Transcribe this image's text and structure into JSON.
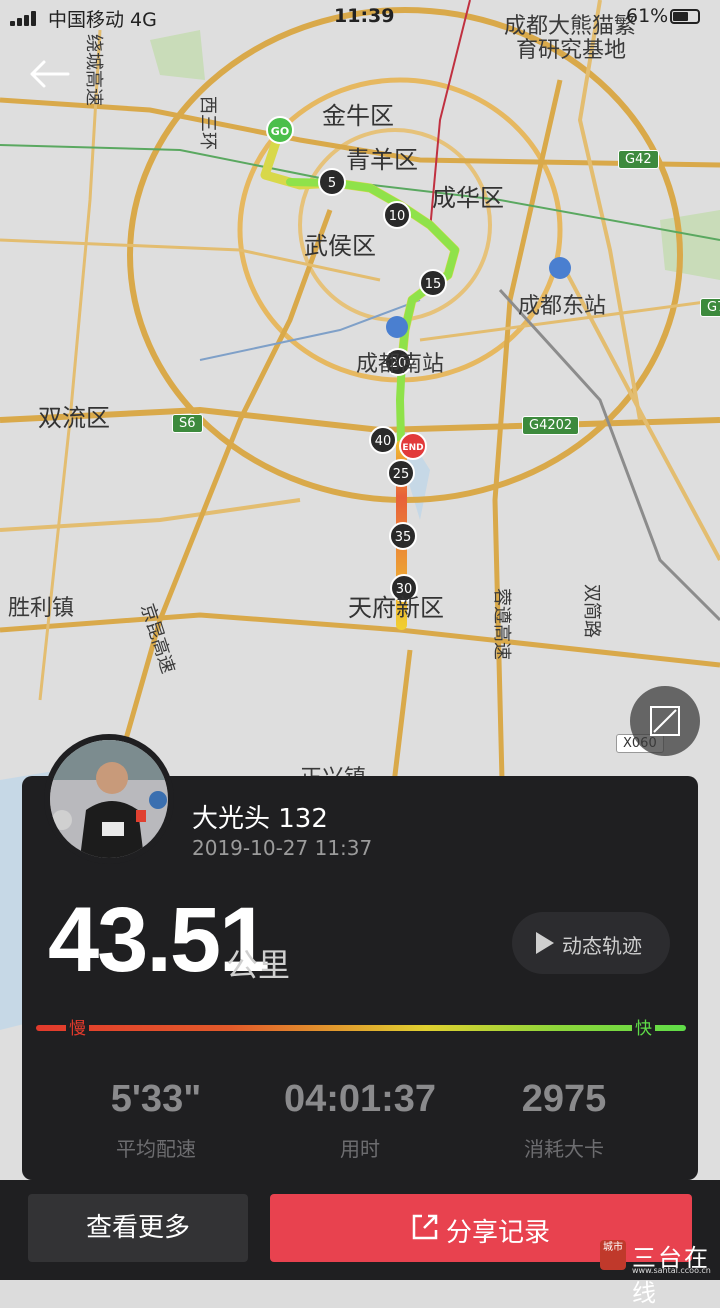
{
  "status_bar": {
    "carrier": "中国移动 4G",
    "time": "11:39",
    "battery": "61%"
  },
  "map": {
    "labels": {
      "jinniu": "金牛区",
      "qingyang": "青羊区",
      "chenghua": "成华区",
      "wuhou": "武侯区",
      "shuangliu": "双流区",
      "tianfu": "天府新区",
      "shenglizhen": "胜利镇",
      "chengdu_dongzhan": "成都东站",
      "chengdu_nanzhan": "成都南站",
      "panda_base_1": "成都大熊猫繁",
      "panda_base_2": "育研究基地",
      "xisanhuan": "西三环",
      "raocheng": "绕城高速",
      "jingkun": "京昆高速",
      "rongzun": "蓉遵高速",
      "shuangjian": "双简路",
      "zhengxing": "正兴镇"
    },
    "shields": {
      "g42": "G42",
      "s6": "S6",
      "g4202": "G4202",
      "g7": "G7",
      "x060": "X060"
    },
    "route_markers": {
      "start": "GO",
      "end": "END",
      "km": [
        "5",
        "10",
        "15",
        "20",
        "25",
        "30",
        "35",
        "40"
      ]
    }
  },
  "summary": {
    "username": "大光头 132",
    "datetime": "2019-10-27 11:37",
    "distance": "43.51",
    "distance_unit": "公里",
    "replay_label": "动态轨迹",
    "speed_slow": "慢",
    "speed_fast": "快",
    "stats": [
      {
        "value": "5'33\"",
        "label": "平均配速"
      },
      {
        "value": "04:01:37",
        "label": "用时"
      },
      {
        "value": "2975",
        "label": "消耗大卡"
      }
    ]
  },
  "actions": {
    "more": "查看更多",
    "share": "分享记录"
  },
  "watermark": {
    "seal": "城市",
    "text": "三台在线",
    "url": "www.santai.ccoo.cn"
  },
  "colors": {
    "share_red": "#e8424f",
    "card_bg": "#1f1f21",
    "route_fast": "#5fdc48",
    "route_slow": "#e23a2c",
    "route_mid": "#f0d030"
  }
}
